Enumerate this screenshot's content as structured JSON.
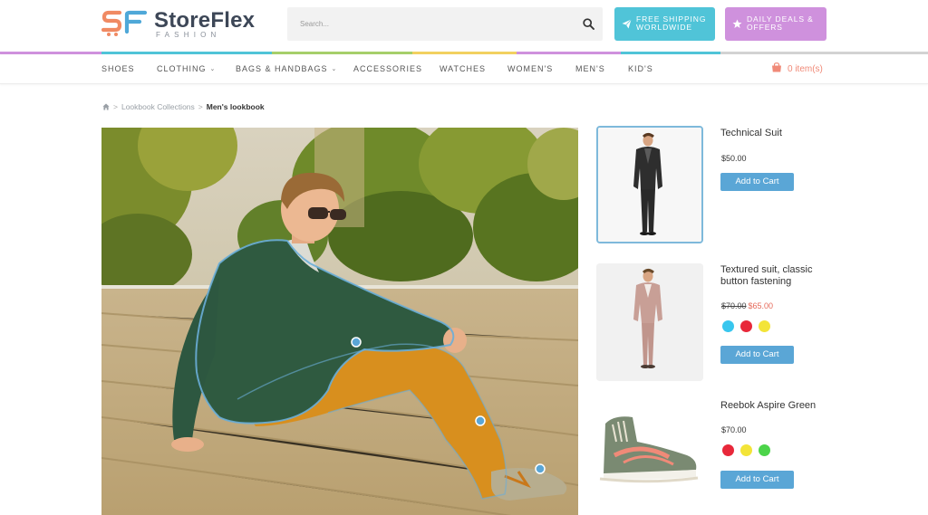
{
  "brand": {
    "name": "StoreFlex",
    "tagline": "FASHION",
    "colors": {
      "orange": "#f08a63",
      "blue": "#4fa8d8",
      "text": "#3d4757"
    }
  },
  "search": {
    "placeholder": "Search..."
  },
  "promos": [
    {
      "icon": "paper-plane-icon",
      "line1": "FREE SHIPPING",
      "line2": "WORLDWIDE",
      "color": "#50c4d8"
    },
    {
      "icon": "star-icon",
      "line1": "DAILY DEALS &",
      "line2": "OFFERS",
      "color": "#cf91dd"
    }
  ],
  "colorbar": [
    "#cf91dd",
    "#50c4d8",
    "#a6cf6a",
    "#f2d160",
    "#cf91dd",
    "#50c4d8",
    "#d3d3d3"
  ],
  "nav": {
    "items": [
      {
        "label": "SHOES",
        "dropdown": false
      },
      {
        "label": "CLOTHING",
        "dropdown": true
      },
      {
        "label": "BAGS & HANDBAGS",
        "dropdown": true
      },
      {
        "label": "ACCESSORIES",
        "dropdown": false
      },
      {
        "label": "WATCHES",
        "dropdown": false
      },
      {
        "label": "WOMEN'S",
        "dropdown": false
      },
      {
        "label": "MEN'S",
        "dropdown": false
      },
      {
        "label": "KID'S",
        "dropdown": false
      }
    ],
    "cart_label": "0 item(s)"
  },
  "breadcrumb": {
    "items": [
      "Lookbook Collections"
    ],
    "current": "Men's lookbook"
  },
  "products": [
    {
      "name": "Technical Suit",
      "price": "$50.00",
      "old_price": "",
      "new_price": "",
      "swatches": [],
      "button": "Add to Cart",
      "active": true
    },
    {
      "name": "Textured suit, classic button fastening",
      "price": "",
      "old_price": "$70.00",
      "new_price": "$65.00",
      "swatches": [
        "#38c6ee",
        "#e8283a",
        "#f3e438"
      ],
      "button": "Add to Cart",
      "active": false
    },
    {
      "name": "Reebok Aspire Green",
      "price": "$70.00",
      "old_price": "",
      "new_price": "",
      "swatches": [
        "#e8283a",
        "#f3e438",
        "#4cd44a"
      ],
      "button": "Add to Cart",
      "active": false
    }
  ],
  "hotspots": [
    "jacket-hotspot",
    "trousers-hotspot",
    "shoes-hotspot"
  ]
}
